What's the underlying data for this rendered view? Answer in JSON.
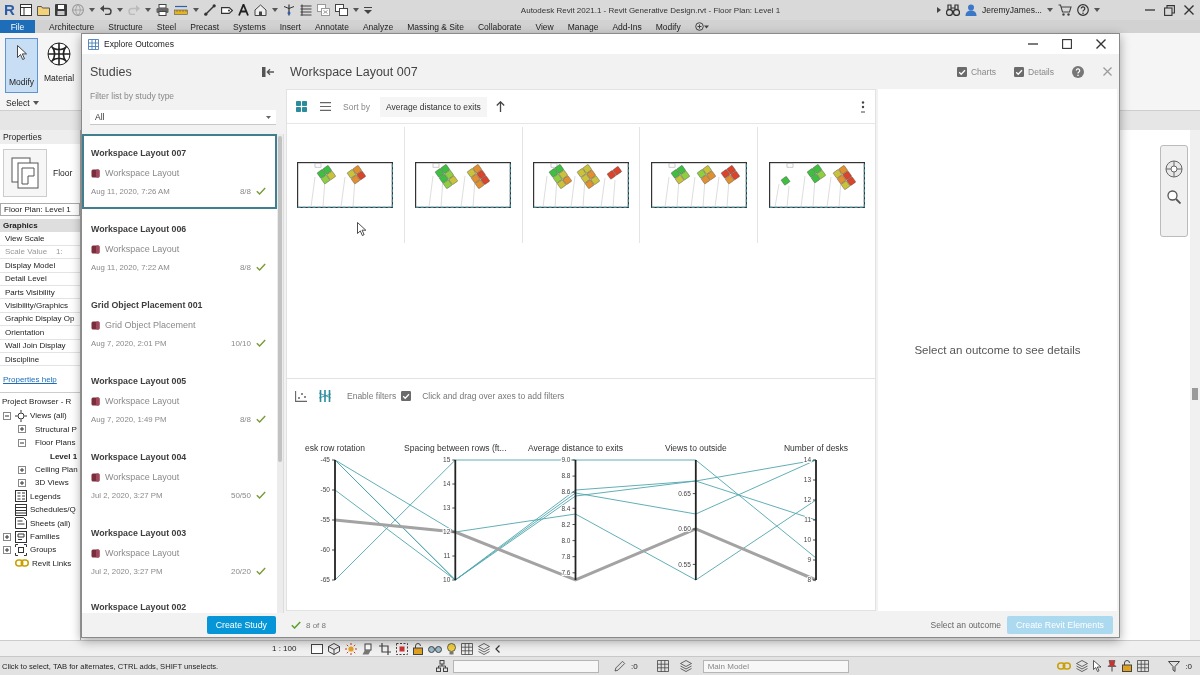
{
  "app": {
    "logo": "R",
    "title": "Autodesk Revit 2021.1 - Revit Generative Design.rvt - Floor Plan: Level 1",
    "user": "JeremyJames..."
  },
  "ribbon": {
    "file_tab": "File",
    "tabs": [
      "Architecture",
      "Structure",
      "Steel",
      "Precast",
      "Systems",
      "Insert",
      "Annotate",
      "Analyze",
      "Massing & Site",
      "Collaborate",
      "View",
      "Manage",
      "Add-Ins",
      "Modify"
    ],
    "modify_button": "Modify",
    "materials_button": "Material",
    "select_menu": "Select"
  },
  "properties": {
    "title": "Properties",
    "type_name": "Floor",
    "instance": "Floor Plan: Level 1",
    "rows": [
      {
        "label": "Graphics",
        "kind": "group",
        "disabled": false
      },
      {
        "label": "View Scale",
        "kind": "param",
        "disabled": false
      },
      {
        "label": "Scale Value",
        "value": "1:",
        "kind": "param",
        "disabled": true
      },
      {
        "label": "Display Model",
        "kind": "param",
        "disabled": false
      },
      {
        "label": "Detail Level",
        "kind": "param",
        "disabled": false
      },
      {
        "label": "Parts Visibility",
        "kind": "param",
        "disabled": false
      },
      {
        "label": "Visibility/Graphics",
        "kind": "param",
        "disabled": false
      },
      {
        "label": "Graphic Display Op",
        "kind": "param",
        "disabled": false
      },
      {
        "label": "Orientation",
        "kind": "param",
        "disabled": false
      },
      {
        "label": "Wall Join Display",
        "kind": "param",
        "disabled": false
      },
      {
        "label": "Discipline",
        "kind": "param",
        "disabled": false
      }
    ],
    "help_link": "Properties help"
  },
  "project_browser": {
    "title": "Project Browser - R",
    "tree": [
      {
        "label": "Views (all)",
        "kind": "views",
        "expanded": true,
        "selected": false,
        "children": [
          {
            "label": "Structural P",
            "expanded": false,
            "selected": false
          },
          {
            "label": "Floor Plans",
            "expanded": true,
            "selected": false,
            "children": [
              {
                "label": "Level 1",
                "selected": true
              }
            ]
          },
          {
            "label": "Ceiling Plan",
            "expanded": false,
            "selected": false
          },
          {
            "label": "3D Views",
            "expanded": false,
            "selected": false
          }
        ]
      },
      {
        "label": "Legends",
        "kind": "legends",
        "selected": false
      },
      {
        "label": "Schedules/Q",
        "kind": "schedules",
        "selected": false
      },
      {
        "label": "Sheets (all)",
        "kind": "sheets",
        "selected": false
      },
      {
        "label": "Families",
        "kind": "families",
        "expanded": false,
        "selected": false
      },
      {
        "label": "Groups",
        "kind": "groups",
        "expanded": false,
        "selected": false
      },
      {
        "label": "Revit Links",
        "kind": "links",
        "selected": false
      }
    ]
  },
  "dialog": {
    "title": "Explore Outcomes"
  },
  "studies": {
    "title": "Studies",
    "filter_label": "Filter list by study type",
    "filter_value": "All",
    "items": [
      {
        "title": "Workspace Layout 007",
        "type": "Workspace Layout",
        "date": "Aug 11, 2020, 7:26 AM",
        "count": "8/8",
        "selected": true
      },
      {
        "title": "Workspace Layout 006",
        "type": "Workspace Layout",
        "date": "Aug 11, 2020, 7:22 AM",
        "count": "8/8",
        "selected": false
      },
      {
        "title": "Grid Object Placement 001",
        "type": "Grid Object Placement",
        "date": "Aug 7, 2020, 2:01 PM",
        "count": "10/10",
        "selected": false
      },
      {
        "title": "Workspace Layout 005",
        "type": "Workspace Layout",
        "date": "Aug 7, 2020, 1:49 PM",
        "count": "8/8",
        "selected": false
      },
      {
        "title": "Workspace Layout 004",
        "type": "Workspace Layout",
        "date": "Jul 2, 2020, 3:27 PM",
        "count": "50/50",
        "selected": false
      },
      {
        "title": "Workspace Layout 003",
        "type": "Workspace Layout",
        "date": "Jul 2, 2020, 3:27 PM",
        "count": "20/20",
        "selected": false
      },
      {
        "title": "Workspace Layout 002",
        "selected": false
      }
    ],
    "create_button": "Create Study"
  },
  "outcomes": {
    "title": "Workspace Layout 007",
    "view_modes": [
      {
        "kind": "grid",
        "selected": true
      },
      {
        "kind": "list",
        "selected": false
      }
    ],
    "sort_label": "Sort by",
    "sort_value": "Average distance to exits",
    "thumbnails": [
      {
        "selected": false
      },
      {
        "selected": false
      },
      {
        "selected": false
      },
      {
        "selected": false
      },
      {
        "selected": false
      }
    ],
    "chart_modes": [
      {
        "kind": "scatter",
        "selected": false
      },
      {
        "kind": "parallel",
        "selected": true
      }
    ],
    "filters_label": "Enable filters",
    "filters_enabled": true,
    "filter_hint": "Click and drag over axes to add filters",
    "parallel_chart": {
      "axes": [
        {
          "label": "esk row rotation",
          "ticks": [
            "-45",
            "-50",
            "-55",
            "-60",
            "-65"
          ]
        },
        {
          "label": "Spacing between rows (ft...",
          "ticks": [
            "15",
            "14",
            "13",
            "12",
            "11",
            "10"
          ]
        },
        {
          "label": "Average distance to exits",
          "ticks": [
            "9.0",
            "8.8",
            "8.6",
            "8.4",
            "8.2",
            "8.0",
            "7.8",
            "7.6"
          ]
        },
        {
          "label": "Views to outside",
          "ticks": [
            "0.65",
            "0.60",
            "0.55"
          ]
        },
        {
          "label": "Number of desks",
          "ticks": [
            "14",
            "13",
            "12",
            "11",
            "10",
            "9",
            "8"
          ]
        }
      ]
    },
    "count": "8 of 8"
  },
  "details": {
    "toggles": [
      {
        "label": "Charts",
        "checked": true
      },
      {
        "label": "Details",
        "checked": true
      }
    ],
    "message": "Select an outcome to see details",
    "status": "Select an outcome",
    "create_button": {
      "label": "Create Revit Elements",
      "disabled": true
    }
  },
  "view_bar": {
    "scale": "1 : 100"
  },
  "status_bar": {
    "message": "Click to select, TAB for alternates, CTRL adds, SHIFT unselects.",
    "count": ":0",
    "model": "Main Model",
    "filter_count": ":0"
  }
}
